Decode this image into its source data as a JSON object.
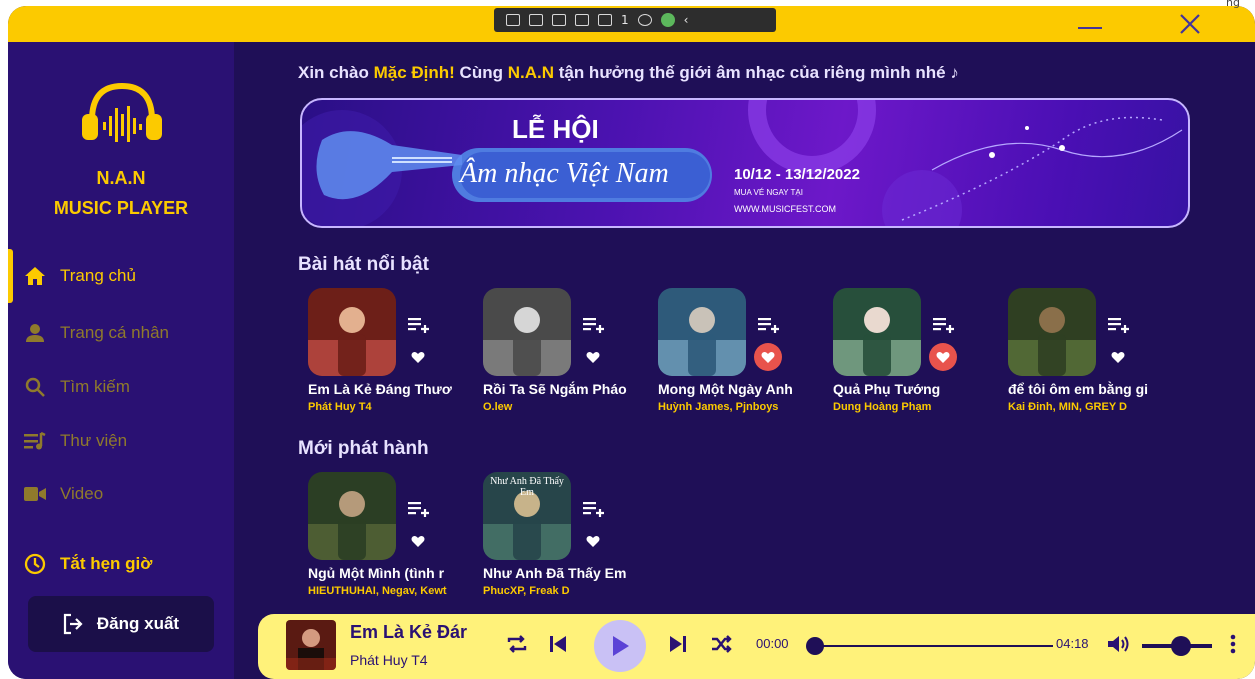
{
  "window": {
    "outside_label": "ng",
    "devbar": {
      "counter": "1"
    }
  },
  "brand": {
    "line1": "N.A.N",
    "line2": "MUSIC PLAYER"
  },
  "nav": {
    "home": "Trang chủ",
    "profile": "Trang cá nhân",
    "search": "Tìm kiếm",
    "library": "Thư viện",
    "video": "Video",
    "timer": "Tắt hẹn giờ",
    "logout": "Đăng xuất"
  },
  "greeting": {
    "prefix": "Xin chào ",
    "user": "Mặc Định!",
    "middle": "  Cùng ",
    "app": "N.A.N",
    "suffix": " tận hưởng thế giới âm nhạc của riêng mình nhé "
  },
  "banner": {
    "title_top": "LỄ HỘI",
    "title_script": "Âm nhạc Việt Nam",
    "dates": "10/12 - 13/12/2022",
    "ticket": "MUA VÉ NGAY TẠI",
    "site": "WWW.MUSICFEST.COM"
  },
  "featured": {
    "title": "Bài hát nổi bật",
    "songs": [
      {
        "title": "Em Là Kẻ Đáng Thươ",
        "artist": "Phát Huy T4",
        "liked": false
      },
      {
        "title": "Rồi Ta Sẽ Ngắm Pháo",
        "artist": "O.lew",
        "liked": false
      },
      {
        "title": "Mong Một Ngày Anh",
        "artist": "Huỳnh James, Pjnboys",
        "liked": true
      },
      {
        "title": "Quả Phụ Tướng",
        "artist": "Dung Hoàng Phạm",
        "liked": true
      },
      {
        "title": "để tôi ôm em bằng gi",
        "artist": "Kai Đinh, MIN, GREY D",
        "liked": false
      }
    ]
  },
  "new_releases": {
    "title": "Mới phát hành",
    "songs": [
      {
        "title": "Ngủ Một Mình (tình r",
        "artist": "HIEUTHUHAI, Negav, Kewt",
        "liked": false
      },
      {
        "title": "Như Anh Đã Thấy Em",
        "artist": "PhucXP, Freak D",
        "liked": false,
        "cover_text": "Như Anh Đã Thấy Em"
      }
    ]
  },
  "player": {
    "title": "Em Là Kẻ Đár",
    "artist": "Phát Huy T4",
    "current_time": "00:00",
    "duration": "04:18",
    "progress": 0,
    "volume": 0.55
  },
  "colors": {
    "accent": "#fcca00",
    "sidebar": "#2a1173",
    "background": "#1f0f57",
    "player": "#fff27a",
    "like": "#e8534c"
  }
}
